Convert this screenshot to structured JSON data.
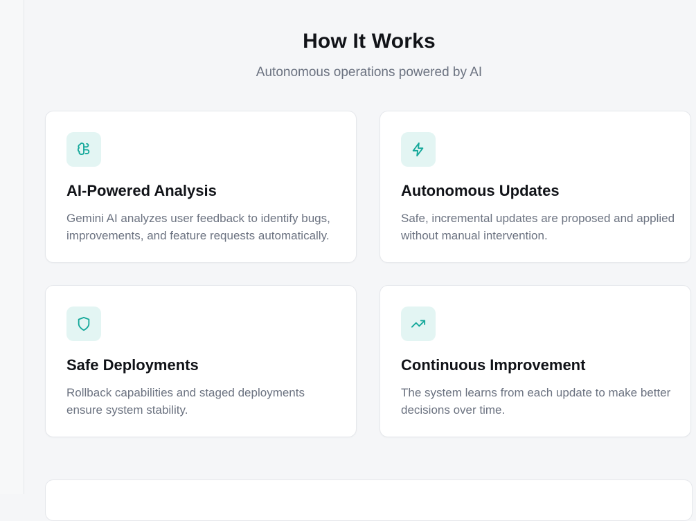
{
  "section": {
    "title": "How It Works",
    "subtitle": "Autonomous operations powered by AI"
  },
  "cards": [
    {
      "icon": "brain-icon",
      "title": "AI-Powered Analysis",
      "description": "Gemini AI analyzes user feedback to identify bugs, improvements, and feature requests automatically."
    },
    {
      "icon": "lightning-icon",
      "title": "Autonomous Updates",
      "description": "Safe, incremental updates are proposed and applied without manual intervention."
    },
    {
      "icon": "shield-icon",
      "title": "Safe Deployments",
      "description": "Rollback capabilities and staged deployments ensure system stability."
    },
    {
      "icon": "trending-up-icon",
      "title": "Continuous Improvement",
      "description": "The system learns from each update to make better decisions over time."
    }
  ],
  "colors": {
    "accent": "#14a89a",
    "icon_background": "#e3f5f3",
    "page_background": "#f5f6f8",
    "card_background": "#ffffff",
    "muted_text": "#6b7280"
  }
}
